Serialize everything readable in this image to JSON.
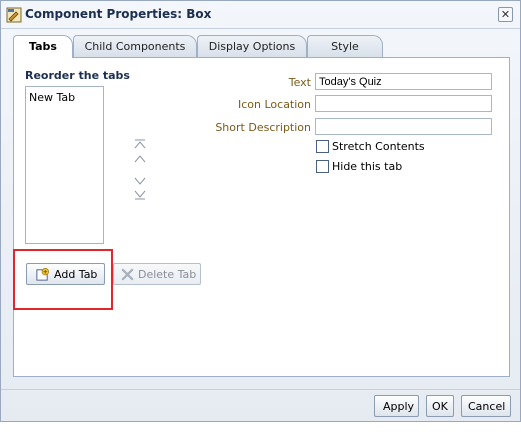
{
  "window": {
    "title": "Component Properties: Box",
    "close_glyph": "✕",
    "icon": "component-icon"
  },
  "tabs": [
    {
      "label": "Tabs",
      "active": true
    },
    {
      "label": "Child Components",
      "active": false
    },
    {
      "label": "Display Options",
      "active": false
    },
    {
      "label": "Style",
      "active": false
    }
  ],
  "reorder": {
    "title": "Reorder the tabs",
    "items": [
      "New Tab"
    ],
    "controls": [
      "move-top-icon",
      "move-up-icon",
      "move-down-icon",
      "move-bottom-icon"
    ]
  },
  "buttons": {
    "add_tab": "Add Tab",
    "delete_tab": "Delete Tab",
    "apply": "Apply",
    "ok": "OK",
    "cancel": "Cancel"
  },
  "form": {
    "text_label": "Text",
    "text_value": "Today's Quiz",
    "icon_location_label": "Icon Location",
    "icon_location_value": "",
    "short_description_label": "Short Description",
    "short_description_value": "",
    "stretch_contents_label": "Stretch Contents",
    "stretch_contents_checked": false,
    "hide_tab_label": "Hide this tab",
    "hide_tab_checked": false
  },
  "colors": {
    "highlight": "#e2262b",
    "label_text": "#7b5a1a",
    "title_text": "#1c2f50"
  }
}
